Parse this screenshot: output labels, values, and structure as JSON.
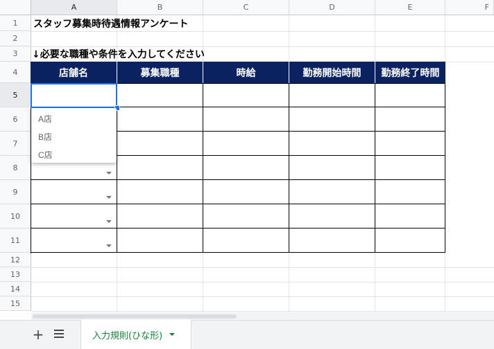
{
  "columns": [
    "A",
    "B",
    "C",
    "D",
    "E",
    "F"
  ],
  "rows": [
    "1",
    "2",
    "3",
    "4",
    "5",
    "6",
    "7",
    "8",
    "9",
    "10",
    "11",
    "12",
    "13",
    "14",
    "15"
  ],
  "cells": {
    "title": "スタッフ募集時待遇情報アンケート",
    "instruction": "↓必要な職種や条件を入力してください"
  },
  "table": {
    "headers": [
      "店舗名",
      "募集職種",
      "時給",
      "勤務開始時間",
      "勤務終了時間"
    ]
  },
  "dropdown": {
    "options": [
      "A店",
      "B店",
      "C店"
    ]
  },
  "sheet_tab": {
    "label": "入力規則(ひな形)"
  },
  "colors": {
    "header_fill": "#0a2260",
    "selection": "#1a73e8",
    "active_tab_text": "#188038"
  }
}
